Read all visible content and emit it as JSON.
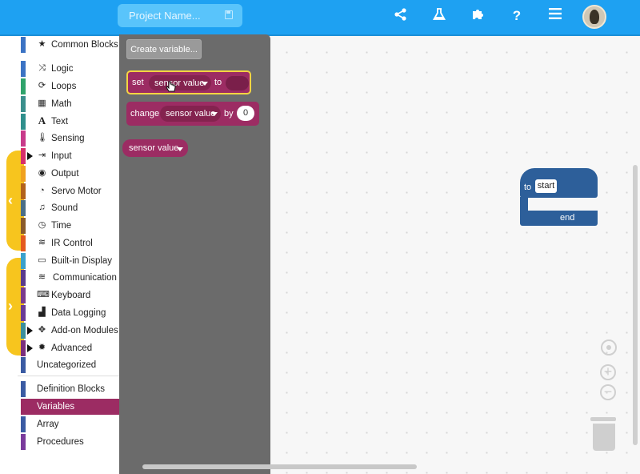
{
  "topbar": {
    "project_placeholder": "Project Name...",
    "icons": [
      "share-icon",
      "flask-icon",
      "puzzle-icon",
      "help-icon",
      "menu-icon"
    ],
    "help_glyph": "?"
  },
  "sidebar": {
    "categories": [
      {
        "label": "Common Blocks",
        "color": "#3b73c4",
        "icon": "star-icon"
      },
      {
        "label": "Logic",
        "color": "#3b73c4",
        "icon": "shuffle-icon"
      },
      {
        "label": "Loops",
        "color": "#2fa36b",
        "icon": "loop-icon"
      },
      {
        "label": "Math",
        "color": "#3a8f8c",
        "icon": "calculator-icon"
      },
      {
        "label": "Text",
        "color": "#2f8f8c",
        "icon": "text-icon"
      },
      {
        "label": "Sensing",
        "color": "#c83a8a",
        "icon": "thermometer-icon"
      },
      {
        "label": "Input",
        "color": "#d72e6a",
        "icon": "sign-in-icon"
      },
      {
        "label": "Output",
        "color": "#f0a11e",
        "icon": "dot-circle-icon"
      },
      {
        "label": "Servo Motor",
        "color": "#b3621a",
        "icon": "servo-icon"
      },
      {
        "label": "Sound",
        "color": "#4a6e87",
        "icon": "music-icon"
      },
      {
        "label": "Time",
        "color": "#8a5b2a",
        "icon": "clock-icon"
      },
      {
        "label": "IR Control",
        "color": "#e45a1e",
        "icon": "wifi-icon"
      },
      {
        "label": "Built-in Display",
        "color": "#3aa1cc",
        "icon": "display-icon"
      },
      {
        "label": "Communication",
        "color": "#5a3b8c",
        "icon": "wifi-icon"
      },
      {
        "label": "Keyboard",
        "color": "#7a3b8c",
        "icon": "keyboard-icon"
      },
      {
        "label": "Data Logging",
        "color": "#6a3b95",
        "icon": "chart-icon"
      },
      {
        "label": "Add-on Modules",
        "color": "#3a8f9c",
        "icon": "puzzle-icon"
      },
      {
        "label": "Advanced",
        "color": "#7a2e7c",
        "icon": "gear-icon"
      },
      {
        "label": "Uncategorized",
        "color": "#3a5ba3",
        "icon": ""
      }
    ],
    "bottom": [
      {
        "label": "Definition Blocks",
        "color": "#3a5ba3"
      },
      {
        "label": "Variables",
        "color": "#9c2c63"
      },
      {
        "label": "Array",
        "color": "#3a5ba3"
      },
      {
        "label": "Procedures",
        "color": "#7a3b9c"
      }
    ]
  },
  "flyout": {
    "create_variable": "Create variable...",
    "set_block": {
      "kw": "set",
      "var": "sensor value",
      "to": "to"
    },
    "change_block": {
      "kw": "change",
      "var": "sensor value",
      "by": "by",
      "amount": "0"
    },
    "getter": {
      "var": "sensor value"
    }
  },
  "workspace": {
    "proc_block": {
      "kw": "to",
      "name": "start",
      "end": "end"
    },
    "zoom_in": "+",
    "zoom_out": "−"
  }
}
